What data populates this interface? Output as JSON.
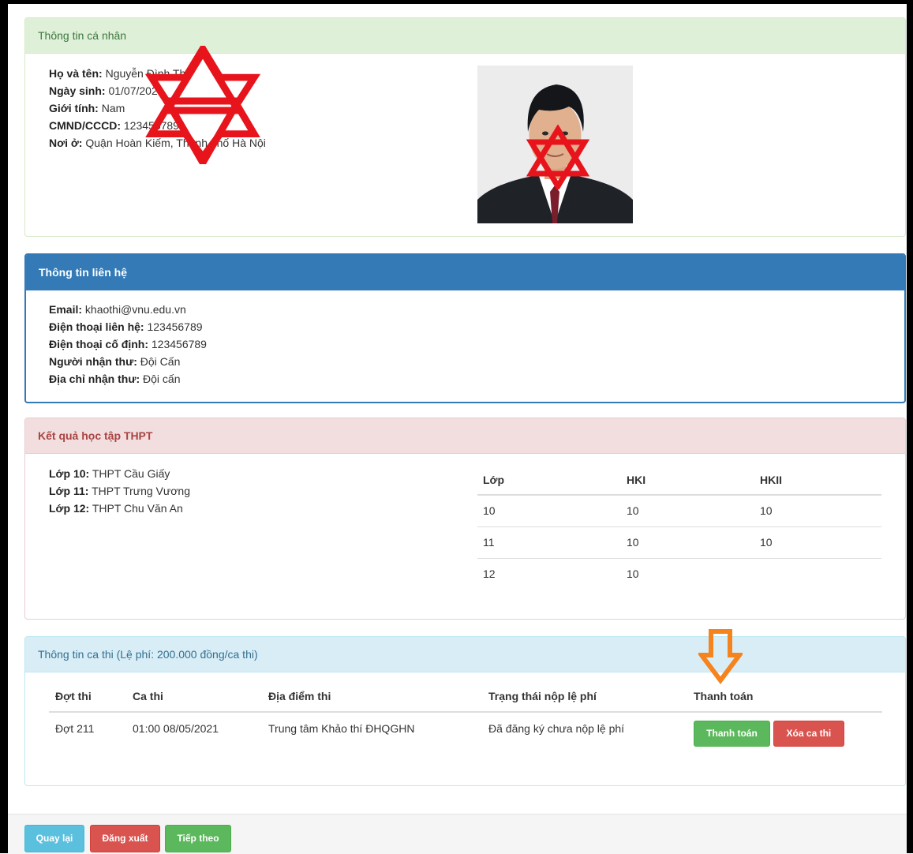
{
  "personal": {
    "heading": "Thông tin cá nhân",
    "fields": [
      {
        "label": "Họ và tên:",
        "value": "Nguyễn Đình Thư"
      },
      {
        "label": "Ngày sinh:",
        "value": "01/07/2021"
      },
      {
        "label": "Giới tính:",
        "value": "Nam"
      },
      {
        "label": "CMND/CCCD:",
        "value": "123456789"
      },
      {
        "label": "Nơi ở:",
        "value": "Quận Hoàn Kiếm, Thành phố Hà Nội"
      }
    ]
  },
  "contact": {
    "heading": "Thông tin liên hệ",
    "fields": [
      {
        "label": "Email:",
        "value": "khaothi@vnu.edu.vn"
      },
      {
        "label": "Điện thoại liên hệ:",
        "value": "123456789"
      },
      {
        "label": "Điện thoại cố định:",
        "value": "123456789"
      },
      {
        "label": "Người nhận thư:",
        "value": "Đội Cấn"
      },
      {
        "label": "Địa chỉ nhận thư:",
        "value": "Đội cấn"
      }
    ]
  },
  "academic": {
    "heading": "Kết quả học tập THPT",
    "schools": [
      {
        "label": "Lớp 10:",
        "value": "THPT Cầu Giấy"
      },
      {
        "label": "Lớp 11:",
        "value": "THPT Trưng Vương"
      },
      {
        "label": "Lớp 12:",
        "value": "THPT Chu Văn An"
      }
    ],
    "table": {
      "headers": [
        "Lớp",
        "HKI",
        "HKII"
      ],
      "rows": [
        [
          "10",
          "10",
          "10"
        ],
        [
          "11",
          "10",
          "10"
        ],
        [
          "12",
          "10",
          ""
        ]
      ]
    }
  },
  "exam": {
    "heading": "Thông tin ca thi (Lệ phí: 200.000 đồng/ca thi)",
    "headers": [
      "Đợt thi",
      "Ca thi",
      "Địa điểm thi",
      "Trạng thái nộp lệ phí",
      "Thanh toán"
    ],
    "row": {
      "dot": "Đợt 211",
      "ca": "01:00 08/05/2021",
      "dia_diem": "Trung tâm Khảo thí ĐHQGHN",
      "trang_thai": "Đã đăng ký chưa nộp lệ phí"
    },
    "pay_button": "Thanh toán",
    "delete_button": "Xóa ca thi"
  },
  "footer": {
    "back": "Quay lại",
    "logout": "Đăng xuất",
    "next": "Tiếp theo"
  },
  "colors": {
    "annotation_red": "#e8141c",
    "annotation_orange": "#f5841f"
  }
}
